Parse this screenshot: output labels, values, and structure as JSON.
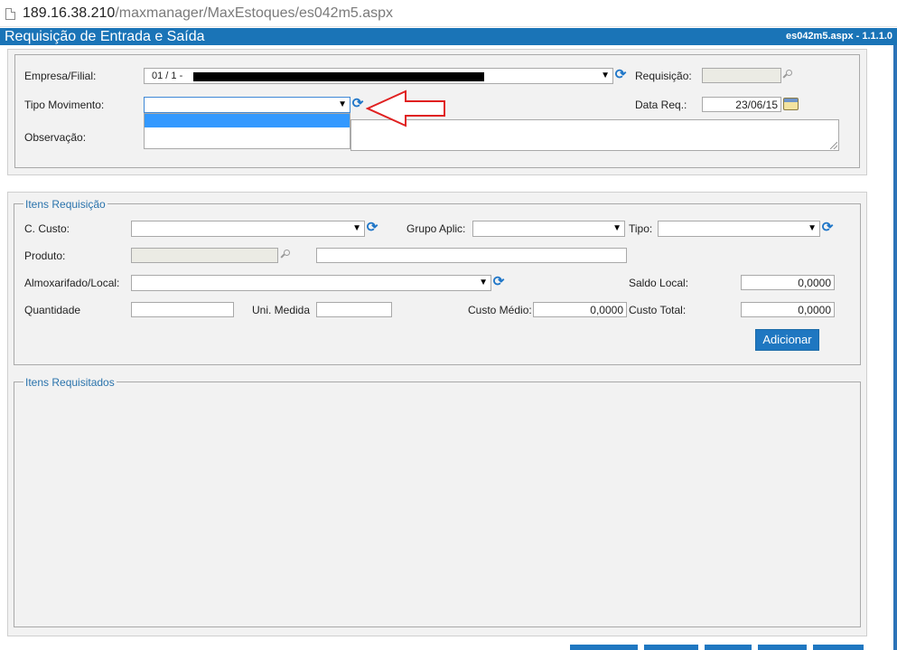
{
  "browser": {
    "url_host": "189.16.38.210",
    "url_path": "/maxmanager/MaxEstoques/es042m5.aspx"
  },
  "titlebar": {
    "title": "Requisição de Entrada e Saída",
    "version": "es042m5.aspx - 1.1.1.0"
  },
  "header_form": {
    "empresa_label": "Empresa/Filial:",
    "empresa_value": "01 / 1 -",
    "requisicao_label": "Requisição:",
    "requisicao_value": "",
    "tipo_movimento_label": "Tipo Movimento:",
    "tipo_movimento_value": "",
    "data_req_label": "Data Req.:",
    "data_req_value": "23/06/15",
    "observacao_label": "Observação:",
    "observacao_value": ""
  },
  "itens_requisicao": {
    "legend": "Itens Requisição",
    "ccusto_label": "C. Custo:",
    "grupo_aplic_label": "Grupo Aplic:",
    "tipo_label": "Tipo:",
    "produto_label": "Produto:",
    "almoxarifado_label": "Almoxarifado/Local:",
    "saldo_local_label": "Saldo Local:",
    "saldo_local_value": "0,0000",
    "quantidade_label": "Quantidade",
    "uni_medida_label": "Uni. Medida",
    "custo_medio_label": "Custo Médio:",
    "custo_medio_value": "0,0000",
    "custo_total_label": "Custo Total:",
    "custo_total_value": "0,0000",
    "adicionar_label": "Adicionar"
  },
  "itens_requisitados": {
    "legend": "Itens Requisitados"
  },
  "colors": {
    "accent": "#1a74b7",
    "highlight": "#3399ff",
    "annotation_arrow": "#e02020"
  },
  "icons": [
    "page-icon",
    "refresh-icon",
    "search-icon",
    "calendar-icon",
    "chevron-down-icon",
    "arrow-annotation"
  ]
}
